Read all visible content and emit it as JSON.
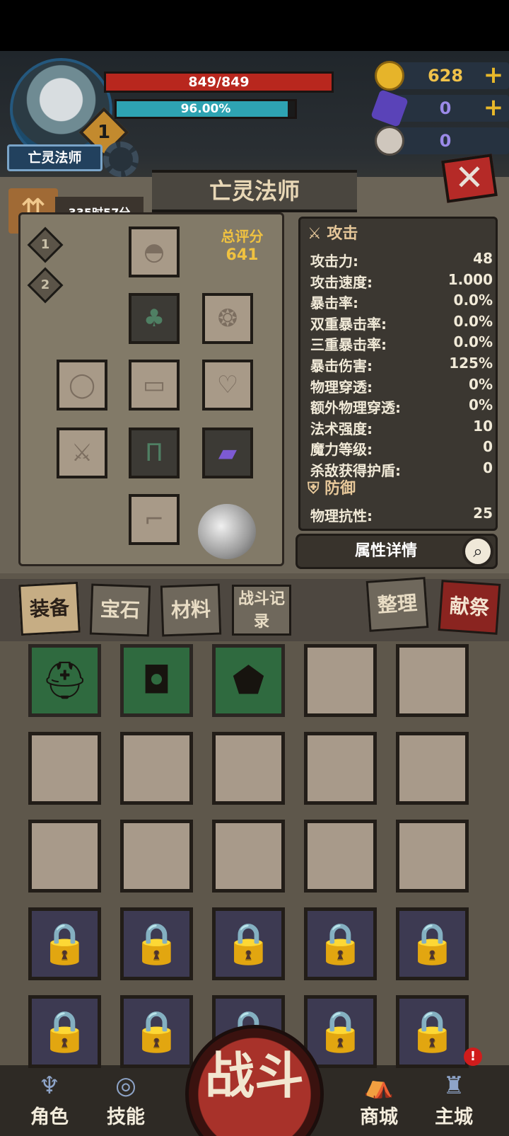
{
  "character": {
    "name": "亡灵法师",
    "level": "1"
  },
  "bars": {
    "hp": "849/849",
    "xp": "96.00%",
    "xp_fraction": 0.96
  },
  "resources": [
    {
      "icon": "gold-coin-icon",
      "value": "628"
    },
    {
      "icon": "purple-crystal-icon",
      "value": "0"
    },
    {
      "icon": "ram-skull-icon",
      "value": "0"
    }
  ],
  "panel": {
    "title": "亡灵法师",
    "awaken_timer": "335时57分",
    "tiers": [
      "1",
      "2"
    ],
    "score_label": "总评分",
    "score_value": "641"
  },
  "stats": {
    "attack_header": "攻击",
    "attack": [
      {
        "k": "攻击力:",
        "v": "48"
      },
      {
        "k": "攻击速度:",
        "v": "1.000"
      },
      {
        "k": "暴击率:",
        "v": "0.0%"
      },
      {
        "k": "双重暴击率:",
        "v": "0.0%"
      },
      {
        "k": "三重暴击率:",
        "v": "0.0%"
      },
      {
        "k": "暴击伤害:",
        "v": "125%"
      },
      {
        "k": "物理穿透:",
        "v": "0%"
      },
      {
        "k": "额外物理穿透:",
        "v": "0%"
      },
      {
        "k": "法术强度:",
        "v": "10"
      },
      {
        "k": "魔力等级:",
        "v": "0"
      },
      {
        "k": "杀敌获得护盾:",
        "v": "0"
      }
    ],
    "defense_header": "防御",
    "defense_partial": {
      "k": "物理抗性:",
      "v": "25"
    },
    "detail_button": "属性详情"
  },
  "tabs": {
    "equip": "装备",
    "gem": "宝石",
    "material": "材料",
    "battle_log": "战斗记录",
    "sort": "整理",
    "sacrifice": "献祭"
  },
  "bottom_nav": {
    "role": "角色",
    "skill": "技能",
    "fight": "战斗",
    "shop": "商城",
    "city": "主城",
    "city_alert": "!"
  }
}
